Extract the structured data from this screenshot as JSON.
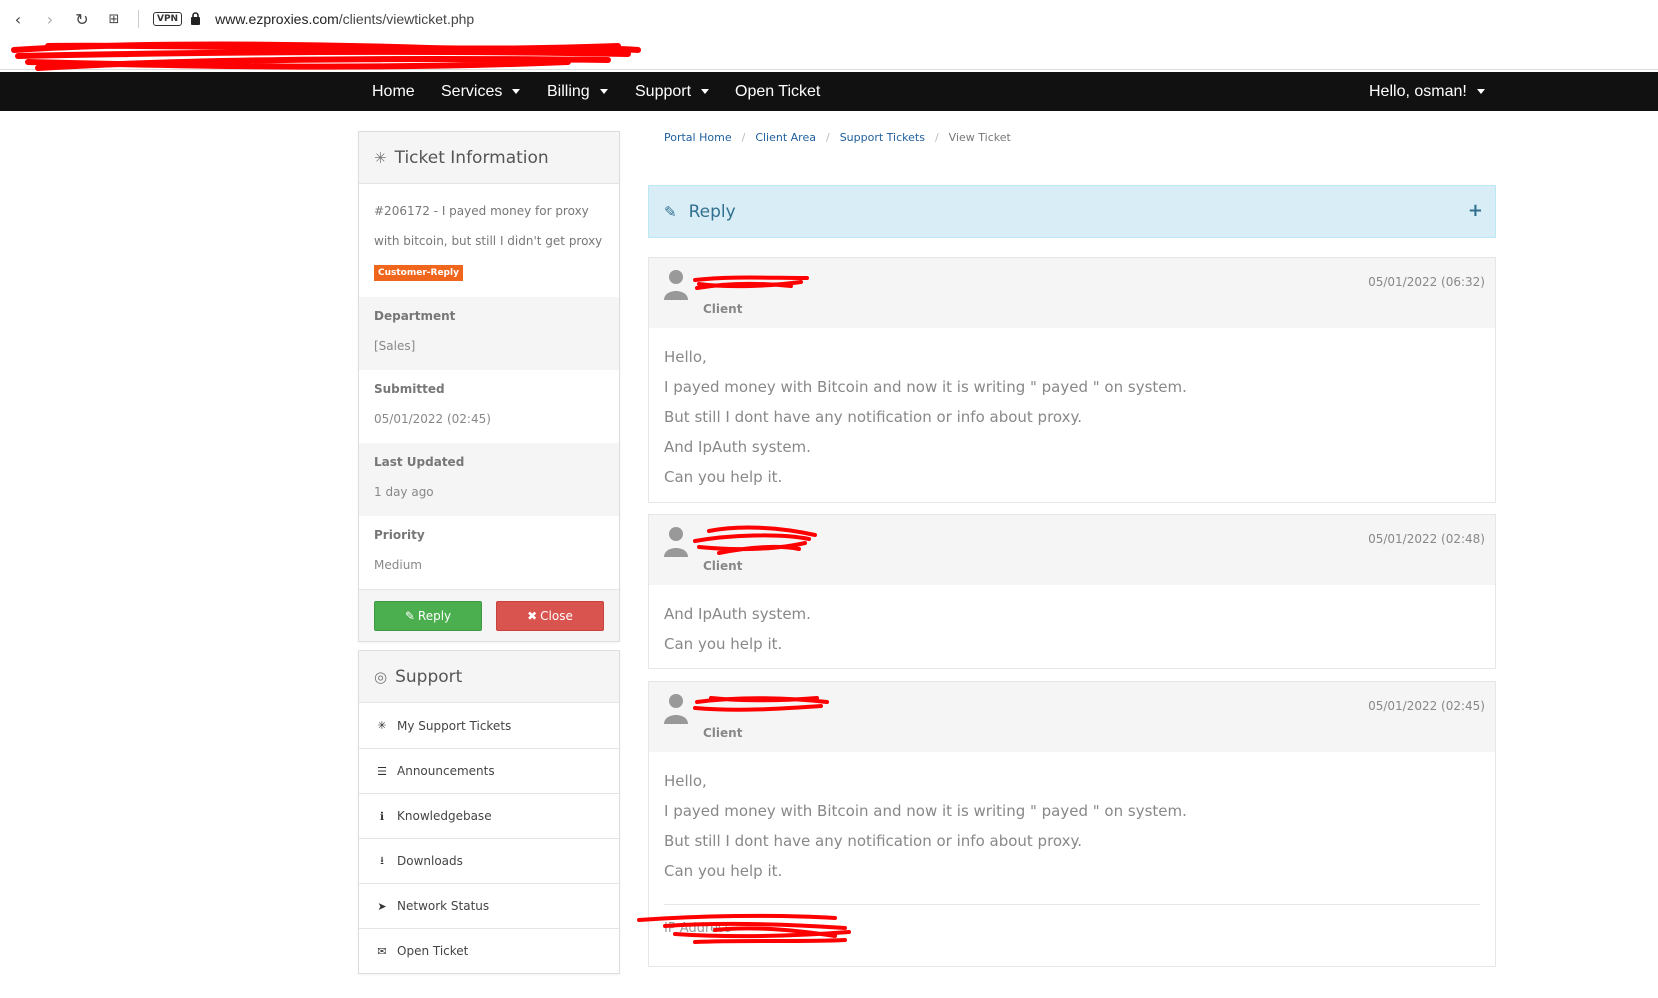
{
  "browser": {
    "url_host": "www.ezproxies.com",
    "url_path": "/clients/viewticket.php",
    "vpn_label": "VPN"
  },
  "nav": {
    "items": [
      {
        "label": "Home",
        "dropdown": false
      },
      {
        "label": "Services",
        "dropdown": true
      },
      {
        "label": "Billing",
        "dropdown": true
      },
      {
        "label": "Support",
        "dropdown": true
      },
      {
        "label": "Open Ticket",
        "dropdown": false
      }
    ],
    "user_menu": "Hello, osman!"
  },
  "ticket_info": {
    "title": "Ticket Information",
    "subject": "#206172 - I payed money for proxy with bitcoin, but still I didn't get proxy",
    "status_badge": "Customer-Reply",
    "status_color": "#f0661c",
    "rows": [
      {
        "label": "Department",
        "value": "[Sales]"
      },
      {
        "label": "Submitted",
        "value": "05/01/2022 (02:45)"
      },
      {
        "label": "Last Updated",
        "value": "1 day ago"
      },
      {
        "label": "Priority",
        "value": "Medium"
      }
    ],
    "reply_button": "Reply",
    "close_button": "Close"
  },
  "support": {
    "title": "Support",
    "items": [
      {
        "label": "My Support Tickets",
        "icon": "ticket-icon"
      },
      {
        "label": "Announcements",
        "icon": "list-icon"
      },
      {
        "label": "Knowledgebase",
        "icon": "info-icon"
      },
      {
        "label": "Downloads",
        "icon": "download-icon"
      },
      {
        "label": "Network Status",
        "icon": "rocket-icon"
      },
      {
        "label": "Open Ticket",
        "icon": "comments-icon"
      }
    ]
  },
  "breadcrumb": [
    "Portal Home",
    "Client Area",
    "Support Tickets",
    "View Ticket"
  ],
  "reply_panel": {
    "label": "Reply",
    "expand": "+"
  },
  "messages": [
    {
      "role": "Client",
      "date": "05/01/2022 (06:32)",
      "lines": [
        "Hello,",
        "I payed money with Bitcoin and now it is writing \" payed \" on system.",
        "But still I dont have any notification or info about proxy.",
        "And IpAuth system.",
        "Can you help it."
      ]
    },
    {
      "role": "Client",
      "date": "05/01/2022 (02:48)",
      "lines": [
        "And IpAuth system.",
        "Can you help it."
      ]
    },
    {
      "role": "Client",
      "date": "05/01/2022 (02:45)",
      "lines": [
        "Hello,",
        "I payed money with Bitcoin and now it is writing \" payed \" on system.",
        "But still I dont have any notification or info about proxy.",
        "Can you help it."
      ],
      "ip_label": "IP Address"
    }
  ],
  "colors": {
    "nav_bg": "#111111",
    "reply_btn": "#4bae4f",
    "close_btn": "#d9534f",
    "reply_bar_bg": "#d9edf7",
    "link": "#1f5f9e",
    "redaction": "#ff0000"
  }
}
